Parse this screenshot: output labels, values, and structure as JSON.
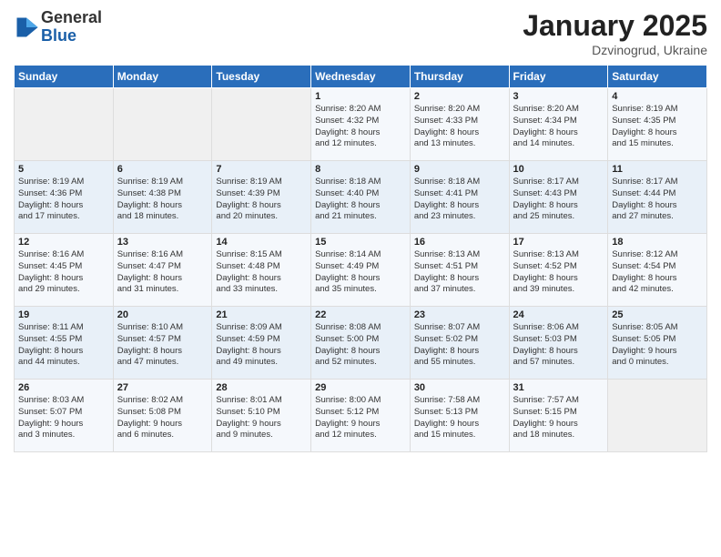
{
  "header": {
    "logo_general": "General",
    "logo_blue": "Blue",
    "month_title": "January 2025",
    "location": "Dzvinogrud, Ukraine"
  },
  "weekdays": [
    "Sunday",
    "Monday",
    "Tuesday",
    "Wednesday",
    "Thursday",
    "Friday",
    "Saturday"
  ],
  "weeks": [
    [
      {
        "day": "",
        "info": ""
      },
      {
        "day": "",
        "info": ""
      },
      {
        "day": "",
        "info": ""
      },
      {
        "day": "1",
        "info": "Sunrise: 8:20 AM\nSunset: 4:32 PM\nDaylight: 8 hours\nand 12 minutes."
      },
      {
        "day": "2",
        "info": "Sunrise: 8:20 AM\nSunset: 4:33 PM\nDaylight: 8 hours\nand 13 minutes."
      },
      {
        "day": "3",
        "info": "Sunrise: 8:20 AM\nSunset: 4:34 PM\nDaylight: 8 hours\nand 14 minutes."
      },
      {
        "day": "4",
        "info": "Sunrise: 8:19 AM\nSunset: 4:35 PM\nDaylight: 8 hours\nand 15 minutes."
      }
    ],
    [
      {
        "day": "5",
        "info": "Sunrise: 8:19 AM\nSunset: 4:36 PM\nDaylight: 8 hours\nand 17 minutes."
      },
      {
        "day": "6",
        "info": "Sunrise: 8:19 AM\nSunset: 4:38 PM\nDaylight: 8 hours\nand 18 minutes."
      },
      {
        "day": "7",
        "info": "Sunrise: 8:19 AM\nSunset: 4:39 PM\nDaylight: 8 hours\nand 20 minutes."
      },
      {
        "day": "8",
        "info": "Sunrise: 8:18 AM\nSunset: 4:40 PM\nDaylight: 8 hours\nand 21 minutes."
      },
      {
        "day": "9",
        "info": "Sunrise: 8:18 AM\nSunset: 4:41 PM\nDaylight: 8 hours\nand 23 minutes."
      },
      {
        "day": "10",
        "info": "Sunrise: 8:17 AM\nSunset: 4:43 PM\nDaylight: 8 hours\nand 25 minutes."
      },
      {
        "day": "11",
        "info": "Sunrise: 8:17 AM\nSunset: 4:44 PM\nDaylight: 8 hours\nand 27 minutes."
      }
    ],
    [
      {
        "day": "12",
        "info": "Sunrise: 8:16 AM\nSunset: 4:45 PM\nDaylight: 8 hours\nand 29 minutes."
      },
      {
        "day": "13",
        "info": "Sunrise: 8:16 AM\nSunset: 4:47 PM\nDaylight: 8 hours\nand 31 minutes."
      },
      {
        "day": "14",
        "info": "Sunrise: 8:15 AM\nSunset: 4:48 PM\nDaylight: 8 hours\nand 33 minutes."
      },
      {
        "day": "15",
        "info": "Sunrise: 8:14 AM\nSunset: 4:49 PM\nDaylight: 8 hours\nand 35 minutes."
      },
      {
        "day": "16",
        "info": "Sunrise: 8:13 AM\nSunset: 4:51 PM\nDaylight: 8 hours\nand 37 minutes."
      },
      {
        "day": "17",
        "info": "Sunrise: 8:13 AM\nSunset: 4:52 PM\nDaylight: 8 hours\nand 39 minutes."
      },
      {
        "day": "18",
        "info": "Sunrise: 8:12 AM\nSunset: 4:54 PM\nDaylight: 8 hours\nand 42 minutes."
      }
    ],
    [
      {
        "day": "19",
        "info": "Sunrise: 8:11 AM\nSunset: 4:55 PM\nDaylight: 8 hours\nand 44 minutes."
      },
      {
        "day": "20",
        "info": "Sunrise: 8:10 AM\nSunset: 4:57 PM\nDaylight: 8 hours\nand 47 minutes."
      },
      {
        "day": "21",
        "info": "Sunrise: 8:09 AM\nSunset: 4:59 PM\nDaylight: 8 hours\nand 49 minutes."
      },
      {
        "day": "22",
        "info": "Sunrise: 8:08 AM\nSunset: 5:00 PM\nDaylight: 8 hours\nand 52 minutes."
      },
      {
        "day": "23",
        "info": "Sunrise: 8:07 AM\nSunset: 5:02 PM\nDaylight: 8 hours\nand 55 minutes."
      },
      {
        "day": "24",
        "info": "Sunrise: 8:06 AM\nSunset: 5:03 PM\nDaylight: 8 hours\nand 57 minutes."
      },
      {
        "day": "25",
        "info": "Sunrise: 8:05 AM\nSunset: 5:05 PM\nDaylight: 9 hours\nand 0 minutes."
      }
    ],
    [
      {
        "day": "26",
        "info": "Sunrise: 8:03 AM\nSunset: 5:07 PM\nDaylight: 9 hours\nand 3 minutes."
      },
      {
        "day": "27",
        "info": "Sunrise: 8:02 AM\nSunset: 5:08 PM\nDaylight: 9 hours\nand 6 minutes."
      },
      {
        "day": "28",
        "info": "Sunrise: 8:01 AM\nSunset: 5:10 PM\nDaylight: 9 hours\nand 9 minutes."
      },
      {
        "day": "29",
        "info": "Sunrise: 8:00 AM\nSunset: 5:12 PM\nDaylight: 9 hours\nand 12 minutes."
      },
      {
        "day": "30",
        "info": "Sunrise: 7:58 AM\nSunset: 5:13 PM\nDaylight: 9 hours\nand 15 minutes."
      },
      {
        "day": "31",
        "info": "Sunrise: 7:57 AM\nSunset: 5:15 PM\nDaylight: 9 hours\nand 18 minutes."
      },
      {
        "day": "",
        "info": ""
      }
    ]
  ]
}
